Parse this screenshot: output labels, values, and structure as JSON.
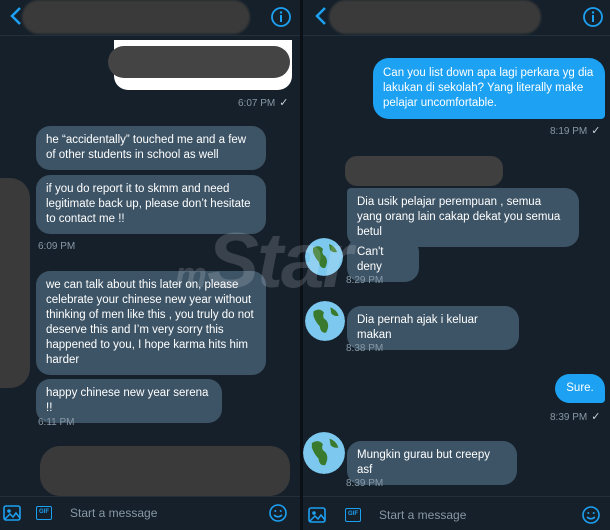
{
  "colors": {
    "bg": "#15202b",
    "received_bubble": "#3d5466",
    "sent_bubble": "#1da1f2",
    "accent": "#1da1f2",
    "timestamp": "#8899a6"
  },
  "left": {
    "top_time": "6:07 PM",
    "msg1": "he “accidentally” touched me and a few of other students in school as well",
    "msg2": "if you do report it to skmm and need legitimate back up, please don’t hesitate to contact me !!",
    "time1": "6:09 PM",
    "msg3": "we can talk about this later on, please celebrate your chinese new year without thinking of men like this , you truly do not deserve this and I’m very sorry this happened to you, I hope karma hits him harder",
    "msg4": "happy chinese new year serena !!",
    "time2": "6:11 PM",
    "composer_placeholder": "Start a message",
    "gif_label": "GIF"
  },
  "right": {
    "msg1": "Can you list down apa lagi perkara yg dia lakukan di sekolah? Yang literally make pelajar uncomfortable.",
    "time1": "8:19 PM",
    "msg2": "Dia usik pelajar perempuan , semua yang orang lain cakap dekat you semua betul",
    "msg3": "Can't deny",
    "time2": "8:29 PM",
    "msg4": "Dia pernah ajak i keluar makan",
    "time3": "8:38 PM",
    "msg5": "Sure.",
    "time4": "8:39 PM",
    "msg6": "Mungkin gurau but creepy asf",
    "time5": "8:39 PM",
    "composer_placeholder": "Start a message",
    "gif_label": "GIF"
  },
  "icons": {
    "back": "chevron-left-icon",
    "info": "info-icon",
    "image": "image-icon",
    "gif": "gif-icon",
    "emoji": "emoji-icon",
    "avatar": "globe-avatar"
  },
  "watermark": {
    "prefix": "m",
    "brand": "Star"
  }
}
